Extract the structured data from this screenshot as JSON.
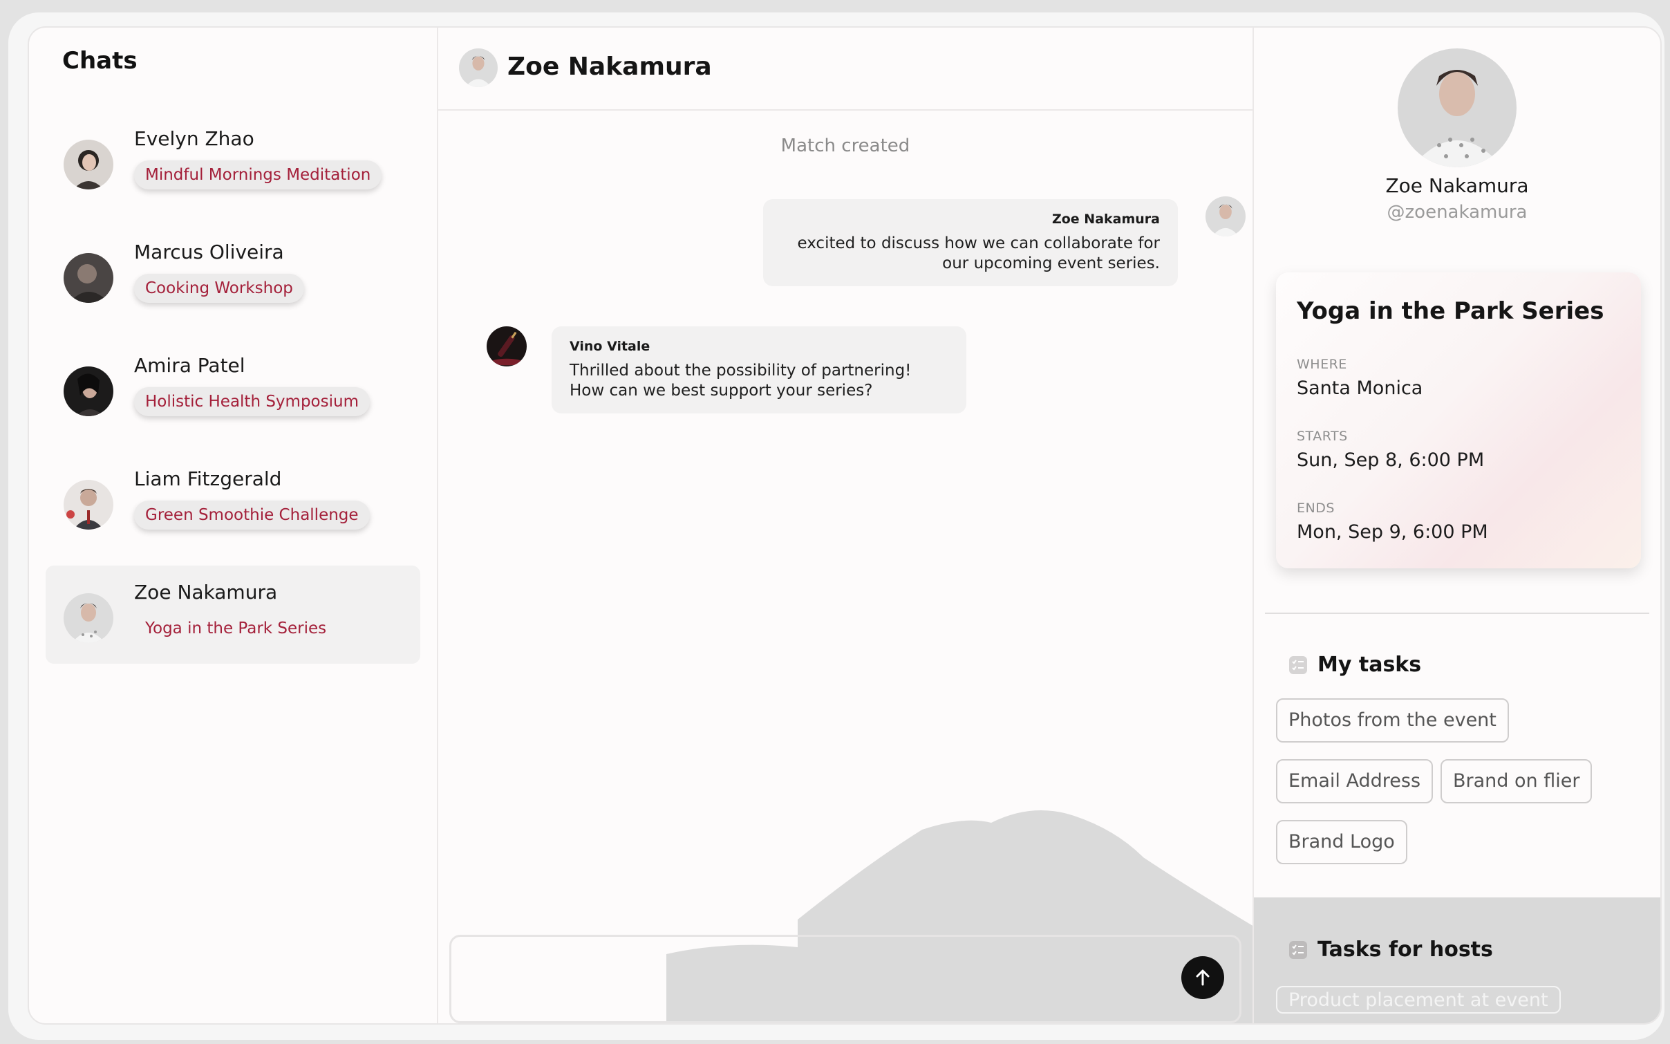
{
  "sidebar": {
    "title": "Chats",
    "chats": [
      {
        "name": "Evelyn Zhao",
        "tag": "Mindful Mornings Meditation"
      },
      {
        "name": "Marcus Oliveira",
        "tag": "Cooking Workshop"
      },
      {
        "name": "Amira Patel",
        "tag": "Holistic Health Symposium"
      },
      {
        "name": "Liam Fitzgerald",
        "tag": "Green Smoothie Challenge"
      },
      {
        "name": "Zoe Nakamura",
        "tag": "Yoga in the Park Series"
      }
    ]
  },
  "chat": {
    "header_name": "Zoe Nakamura",
    "system_note": "Match created",
    "messages": [
      {
        "sender": "Zoe Nakamura",
        "text": "excited to discuss how we can collaborate for our upcoming event series."
      },
      {
        "sender": "Vino Vitale",
        "text": "Thrilled about the possibility of partnering! How can we best support your series?"
      }
    ],
    "composer_placeholder": ""
  },
  "profile": {
    "name": "Zoe Nakamura",
    "handle": "@zoenakamura"
  },
  "event": {
    "title": "Yoga in the Park Series",
    "where_label": "WHERE",
    "where": "Santa Monica",
    "starts_label": "STARTS",
    "starts": "Sun, Sep 8, 6:00 PM",
    "ends_label": "ENDS",
    "ends": "Mon, Sep 9, 6:00 PM"
  },
  "my_tasks": {
    "title": "My tasks",
    "items": [
      "Photos from the event",
      "Email Address",
      "Brand on flier",
      "Brand Logo"
    ]
  },
  "host_tasks": {
    "title": "Tasks for hosts",
    "items": [
      "Product placement at event"
    ]
  },
  "colors": {
    "tag_text": "#a4203a",
    "accent_dark": "#111111"
  }
}
